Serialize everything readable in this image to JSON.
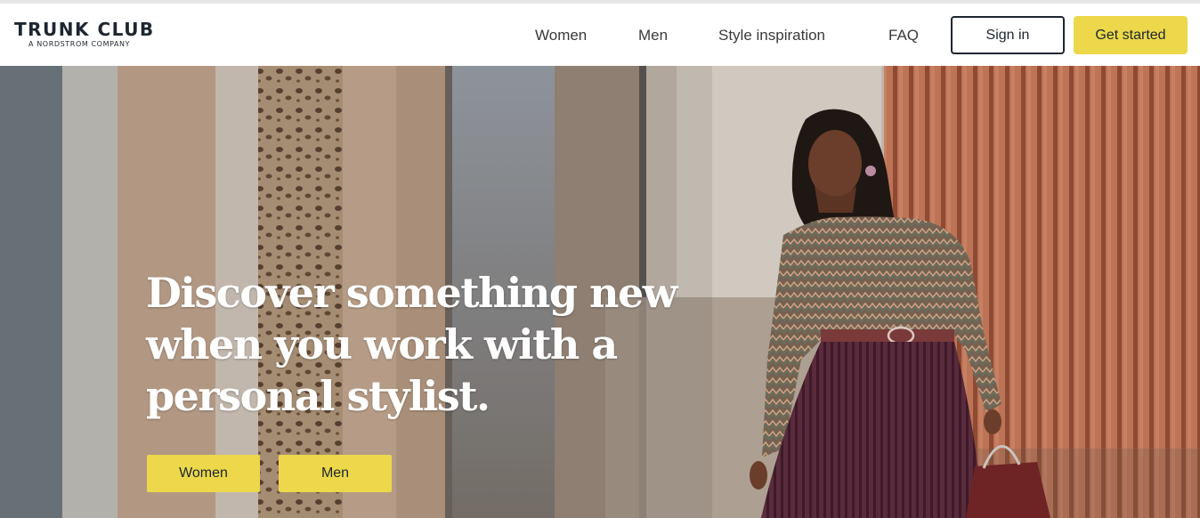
{
  "brand": {
    "name": "TRUNK CLUB",
    "tagline": "A NORDSTROM COMPANY"
  },
  "nav": {
    "links": [
      {
        "label": "Women"
      },
      {
        "label": "Men"
      },
      {
        "label": "Style inspiration"
      },
      {
        "label": "FAQ"
      }
    ],
    "sign_in": "Sign in",
    "get_started": "Get started"
  },
  "hero": {
    "headline_lines": [
      "Discover something new",
      "when you work with a",
      "personal stylist."
    ],
    "cta_women": "Women",
    "cta_men": "Men"
  },
  "colors": {
    "accent": "#ecd84a",
    "text_dark": "#1e2630",
    "header_bg": "#ffffff"
  }
}
